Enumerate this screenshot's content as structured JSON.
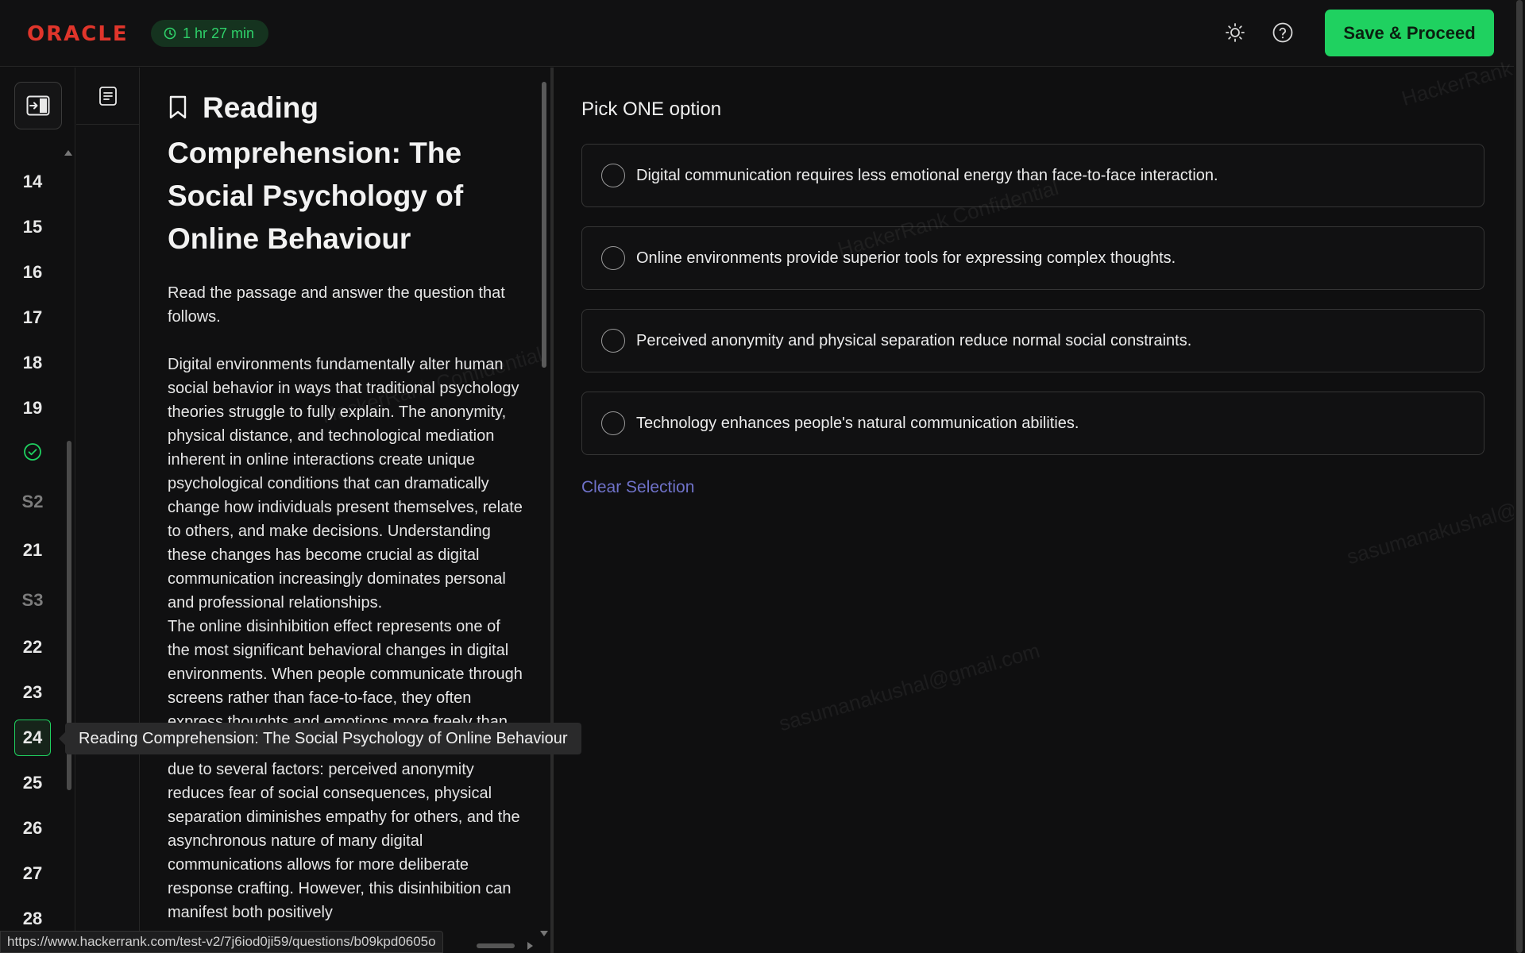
{
  "header": {
    "logo": "ORACLE",
    "timer": "1 hr 27 min",
    "save_label": "Save & Proceed",
    "theme_icon": "sun-icon",
    "help_icon": "help-circle-icon"
  },
  "question_nav": {
    "items": [
      {
        "label": "14",
        "type": "question"
      },
      {
        "label": "15",
        "type": "question"
      },
      {
        "label": "16",
        "type": "question"
      },
      {
        "label": "17",
        "type": "question"
      },
      {
        "label": "18",
        "type": "question"
      },
      {
        "label": "19",
        "type": "question"
      },
      {
        "label": "",
        "type": "answered",
        "icon": "check-circle-icon"
      },
      {
        "label": "S2",
        "type": "section"
      },
      {
        "label": "21",
        "type": "question"
      },
      {
        "label": "S3",
        "type": "section"
      },
      {
        "label": "22",
        "type": "question"
      },
      {
        "label": "23",
        "type": "question"
      },
      {
        "label": "24",
        "type": "current"
      },
      {
        "label": "25",
        "type": "question"
      },
      {
        "label": "26",
        "type": "question"
      },
      {
        "label": "27",
        "type": "question"
      },
      {
        "label": "28",
        "type": "question"
      }
    ]
  },
  "passage": {
    "title": "Reading Comprehension: The Social Psychology of Online Behaviour",
    "intro": "Read the passage and answer the question that follows.",
    "body": "Digital environments fundamentally alter human social behavior in ways that traditional psychology theories struggle to fully explain. The anonymity, physical distance, and technological mediation inherent in online interactions create unique psychological conditions that can dramatically change how individuals present themselves, relate to others, and make decisions. Understanding these changes has become crucial as digital communication increasingly dominates personal and professional relationships.\nThe online disinhibition effect represents one of the most significant behavioral changes in digital environments. When people communicate through screens rather than face-to-face, they often express thoughts and emotions more freely than they would in person. This phenomenon occurs due to several factors: perceived anonymity reduces fear of social consequences, physical separation diminishes empathy for others, and the asynchronous nature of many digital communications allows for more deliberate response crafting. However, this disinhibition can manifest both positively"
  },
  "question": {
    "prompt": "Pick ONE option",
    "options": [
      "Digital communication requires less emotional energy than face-to-face interaction.",
      "Online environments provide superior tools for expressing complex thoughts.",
      "Perceived anonymity and physical separation reduce normal social constraints.",
      "Technology enhances people's natural communication abilities."
    ],
    "clear_label": "Clear Selection"
  },
  "tooltip": {
    "text": "Reading Comprehension: The Social Psychology of Online Behaviour"
  },
  "watermarks": [
    "HackerRank Confidential",
    "HackerRank Confidential",
    "sasumanakushal@gmail.com",
    "sasumanakushal@gmail.com",
    "HackerRank Confidential"
  ],
  "status_bar": {
    "url": "https://www.hackerrank.com/test-v2/7j6iod0ji59/questions/b09kpd0605o"
  },
  "colors": {
    "accent_green": "#1fd160",
    "logo_red": "#e0352b",
    "link_blue": "#6f72c9"
  }
}
